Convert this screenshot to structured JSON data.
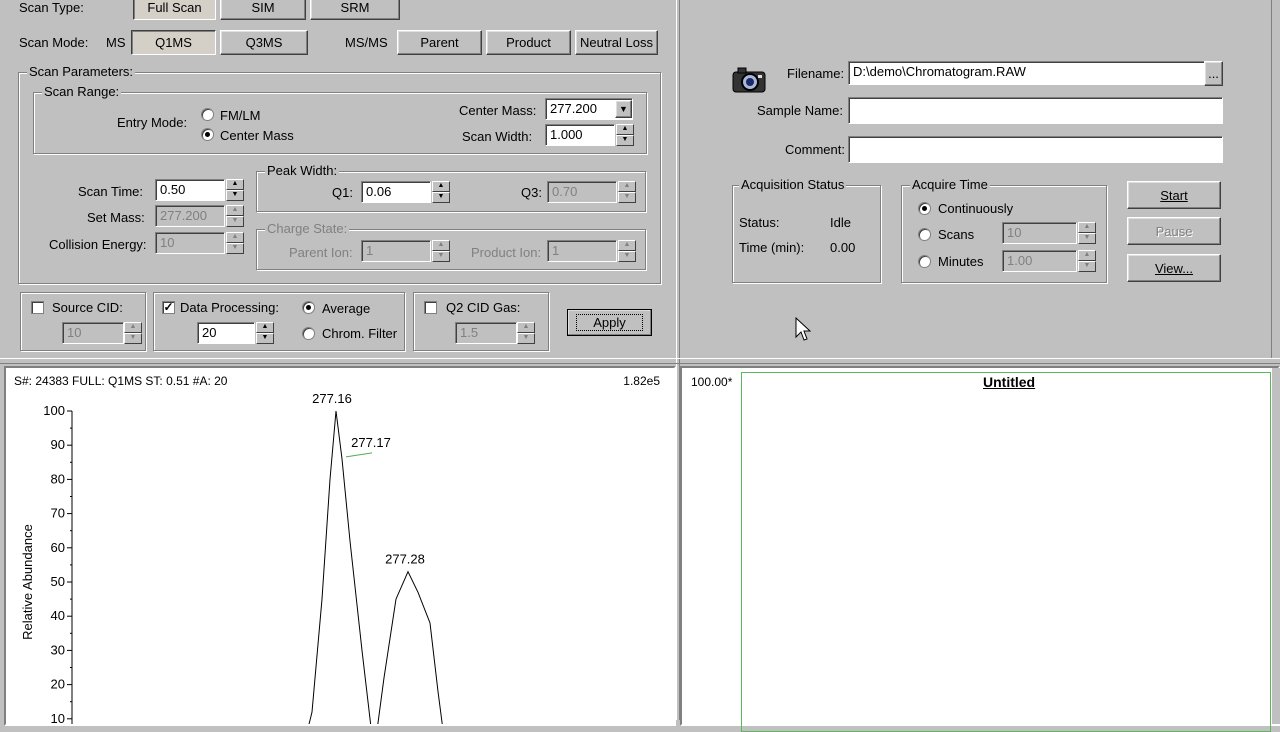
{
  "scan_type": {
    "label": "Scan Type:",
    "buttons": [
      "Full Scan",
      "SIM",
      "SRM"
    ],
    "selected": "Full Scan"
  },
  "scan_mode": {
    "label": "Scan Mode:",
    "ms_label": "MS",
    "ms_buttons": [
      "Q1MS",
      "Q3MS"
    ],
    "selected": "Q1MS",
    "msms_label": "MS/MS",
    "msms_buttons": [
      "Parent",
      "Product",
      "Neutral Loss"
    ]
  },
  "scan_parameters": {
    "title": "Scan Parameters:",
    "scan_range": {
      "title": "Scan Range:",
      "entry_mode_label": "Entry Mode:",
      "options": [
        "FM/LM",
        "Center Mass"
      ],
      "selected": "Center Mass",
      "center_mass_label": "Center Mass:",
      "center_mass_value": "277.200",
      "scan_width_label": "Scan Width:",
      "scan_width_value": "1.000"
    },
    "scan_time_label": "Scan Time:",
    "scan_time_value": "0.50",
    "set_mass_label": "Set Mass:",
    "set_mass_value": "277.200",
    "collision_energy_label": "Collision Energy:",
    "collision_energy_value": "10",
    "peak_width": {
      "title": "Peak Width:",
      "q1_label": "Q1:",
      "q1_value": "0.06",
      "q3_label": "Q3:",
      "q3_value": "0.70"
    },
    "charge_state": {
      "title": "Charge State:",
      "parent_label": "Parent Ion:",
      "parent_value": "1",
      "product_label": "Product Ion:",
      "product_value": "1"
    }
  },
  "source_cid": {
    "label": "Source CID:",
    "value": "10",
    "checked": false
  },
  "data_processing": {
    "label": "Data Processing:",
    "checked": true,
    "value": "20",
    "options": [
      "Average",
      "Chrom. Filter"
    ],
    "selected": "Average"
  },
  "q2_cid_gas": {
    "label": "Q2 CID Gas:",
    "value": "1.5",
    "checked": false
  },
  "apply_label": "Apply",
  "file_info": {
    "filename_label": "Filename:",
    "filename_value": "D:\\demo\\Chromatogram.RAW",
    "browse_label": "...",
    "sample_name_label": "Sample Name:",
    "sample_name_value": "",
    "comment_label": "Comment:",
    "comment_value": ""
  },
  "acquisition_status": {
    "title": "Acquisition Status",
    "status_label": "Status:",
    "status_value": "Idle",
    "time_label": "Time (min):",
    "time_value": "0.00"
  },
  "acquire_time": {
    "title": "Acquire Time",
    "options": [
      "Continuously",
      "Scans",
      "Minutes"
    ],
    "selected": "Continuously",
    "scans_value": "10",
    "minutes_value": "1.00"
  },
  "actions": {
    "start": "Start",
    "pause": "Pause",
    "view": "View..."
  },
  "spectrum": {
    "header": "S#: 24383  FULL: Q1MS  ST: 0.51  #A: 20",
    "max_intensity": "1.82e5"
  },
  "chromatogram": {
    "title": "Untitled",
    "y_max_label": "100.00*"
  },
  "chart_data": {
    "type": "line",
    "ylabel": "Relative Abundance",
    "ylim": [
      0,
      100
    ],
    "yticks": [
      10,
      20,
      30,
      40,
      50,
      60,
      70,
      80,
      90,
      100
    ],
    "peaks": [
      {
        "label": "277.16",
        "y": 100
      },
      {
        "label": "277.17",
        "y": 86
      },
      {
        "label": "277.28",
        "y": 53
      }
    ],
    "profile_y": [
      0,
      12,
      45,
      80,
      100,
      86,
      62,
      30,
      0,
      22,
      45,
      53,
      47,
      38,
      18,
      0
    ]
  },
  "colors": {
    "window_bg": "#c0c0c0",
    "plot_bg": "#ffffff",
    "chrom_frame": "#5cb85c",
    "label_line": "#4caf50"
  }
}
